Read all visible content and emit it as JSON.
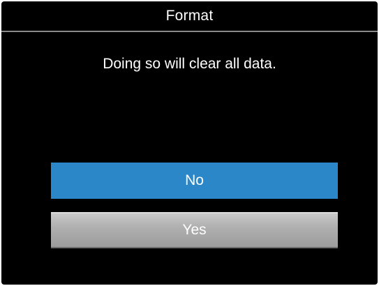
{
  "dialog": {
    "title": "Format",
    "message": "Doing so will clear all data.",
    "buttons": {
      "no_label": "No",
      "yes_label": "Yes"
    },
    "selected": "No"
  },
  "colors": {
    "background": "#000000",
    "selected_button": "#2b87c8",
    "unselected_button": "#b0b0b0",
    "text": "#ffffff"
  }
}
